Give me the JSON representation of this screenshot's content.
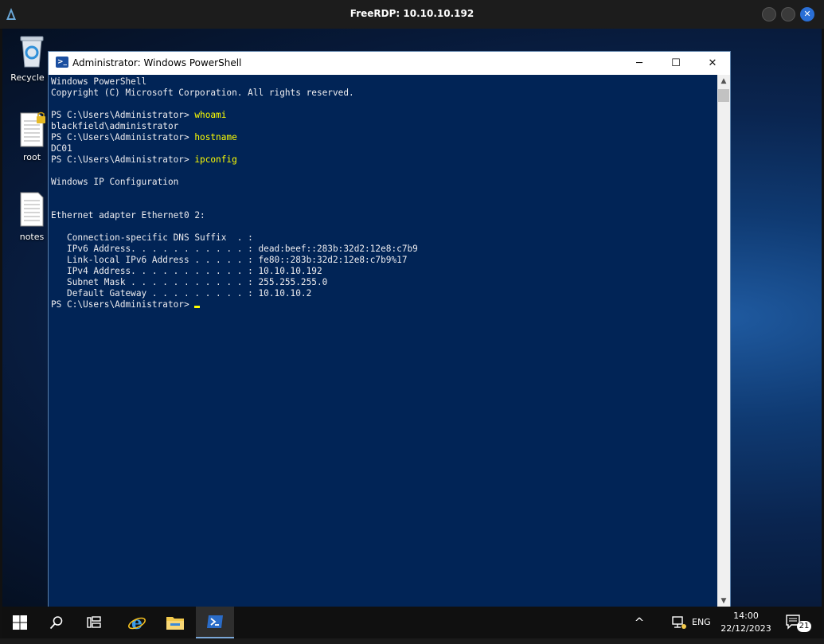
{
  "freerdp": {
    "title": "FreeRDP: 10.10.10.192",
    "close_glyph": "✕"
  },
  "desktop": {
    "icons": [
      {
        "label": "Recycle B",
        "icon": "recycle-bin-icon"
      },
      {
        "label": "root",
        "icon": "locked-text-file-icon"
      },
      {
        "label": "notes",
        "icon": "text-file-icon"
      }
    ]
  },
  "powershell": {
    "title": "Administrator: Windows PowerShell",
    "icon_glyph": ">_",
    "buttons": {
      "minimize": "─",
      "maximize": "☐",
      "close": "✕"
    },
    "prompt": "PS C:\\Users\\Administrator> ",
    "lines": {
      "l1": "Windows PowerShell",
      "l2": "Copyright (C) Microsoft Corporation. All rights reserved.",
      "cmd1": "whoami",
      "out1": "blackfield\\administrator",
      "cmd2": "hostname",
      "out2": "DC01",
      "cmd3": "ipconfig",
      "ipcfg_title": "Windows IP Configuration",
      "adapter": "Ethernet adapter Ethernet0 2:",
      "dns": "   Connection-specific DNS Suffix  . :",
      "ipv6": "   IPv6 Address. . . . . . . . . . . : dead:beef::283b:32d2:12e8:c7b9",
      "ll_ipv6": "   Link-local IPv6 Address . . . . . : fe80::283b:32d2:12e8:c7b9%17",
      "ipv4": "   IPv4 Address. . . . . . . . . . . : 10.10.10.192",
      "mask": "   Subnet Mask . . . . . . . . . . . : 255.255.255.0",
      "gateway": "   Default Gateway . . . . . . . . . : 10.10.10.2"
    },
    "scroll": {
      "up": "▲",
      "down": "▼"
    }
  },
  "taskbar": {
    "items": [
      "start-icon",
      "search-icon",
      "task-view-icon",
      "internet-explorer-icon",
      "file-explorer-icon",
      "powershell-icon"
    ],
    "tray_chevron": "^",
    "language": "ENG",
    "time": "14:00",
    "date": "22/12/2023",
    "notification_count": "21"
  },
  "colors": {
    "console_bg": "#012456",
    "console_fg": "#eeedf0",
    "command": "#ffff00",
    "taskbar": "#101010"
  }
}
